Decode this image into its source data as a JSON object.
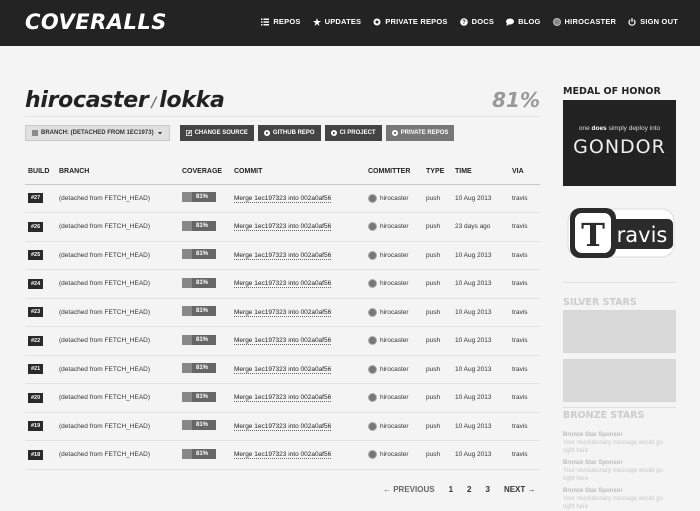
{
  "app": {
    "logo": "COVERALLS"
  },
  "nav": [
    {
      "label": "REPOS",
      "icon": "list-icon"
    },
    {
      "label": "UPDATES",
      "icon": "star-icon"
    },
    {
      "label": "PRIVATE REPOS",
      "icon": "circle-icon"
    },
    {
      "label": "DOCS",
      "icon": "question-icon"
    },
    {
      "label": "BLOG",
      "icon": "chat-icon"
    },
    {
      "label": "HIROCASTER",
      "icon": "avatar"
    },
    {
      "label": "SIGN OUT",
      "icon": "power-icon"
    }
  ],
  "repo": {
    "owner": "hirocaster",
    "separator": "/",
    "name": "lokka",
    "coverage": "81%"
  },
  "toolbar": {
    "branch_label": "BRANCH: (DETACHED FROM 1EC1973)",
    "change_source": "CHANGE SOURCE",
    "github_repo": "GITHUB REPO",
    "ci_project": "CI PROJECT",
    "private_repos": "PRIVATE REPOS"
  },
  "table": {
    "headers": [
      "BUILD",
      "BRANCH",
      "COVERAGE",
      "COMMIT",
      "COMMITTER",
      "TYPE",
      "TIME",
      "VIA"
    ],
    "rows": [
      {
        "build": "#27",
        "branch": "(detached from FETCH_HEAD)",
        "coverage": "81%",
        "commit": "Merge 1ec197323 into 002a0af56",
        "committer": "hirocaster",
        "type": "push",
        "time": "10 Aug 2013",
        "via": "travis"
      },
      {
        "build": "#26",
        "branch": "(detached from FETCH_HEAD)",
        "coverage": "81%",
        "commit": "Merge 1ec197323 into 002a0af56",
        "committer": "hirocaster",
        "type": "push",
        "time": "23 days ago",
        "via": "travis"
      },
      {
        "build": "#25",
        "branch": "(detached from FETCH_HEAD)",
        "coverage": "81%",
        "commit": "Merge 1ec197323 into 002a0af56",
        "committer": "hirocaster",
        "type": "push",
        "time": "10 Aug 2013",
        "via": "travis"
      },
      {
        "build": "#24",
        "branch": "(detached from FETCH_HEAD)",
        "coverage": "81%",
        "commit": "Merge 1ec197323 into 002a0af56",
        "committer": "hirocaster",
        "type": "push",
        "time": "10 Aug 2013",
        "via": "travis"
      },
      {
        "build": "#23",
        "branch": "(detached from FETCH_HEAD)",
        "coverage": "81%",
        "commit": "Merge 1ec197323 into 002a0af56",
        "committer": "hirocaster",
        "type": "push",
        "time": "10 Aug 2013",
        "via": "travis"
      },
      {
        "build": "#22",
        "branch": "(detached from FETCH_HEAD)",
        "coverage": "81%",
        "commit": "Merge 1ec197323 into 002a0af56",
        "committer": "hirocaster",
        "type": "push",
        "time": "10 Aug 2013",
        "via": "travis"
      },
      {
        "build": "#21",
        "branch": "(detached from FETCH_HEAD)",
        "coverage": "81%",
        "commit": "Merge 1ec197323 into 002a0af56",
        "committer": "hirocaster",
        "type": "push",
        "time": "10 Aug 2013",
        "via": "travis"
      },
      {
        "build": "#20",
        "branch": "(detached from FETCH_HEAD)",
        "coverage": "81%",
        "commit": "Merge 1ec197323 into 002a0af56",
        "committer": "hirocaster",
        "type": "push",
        "time": "10 Aug 2013",
        "via": "travis"
      },
      {
        "build": "#19",
        "branch": "(detached from FETCH_HEAD)",
        "coverage": "81%",
        "commit": "Merge 1ec197323 into 002a0af56",
        "committer": "hirocaster",
        "type": "push",
        "time": "10 Aug 2013",
        "via": "travis"
      },
      {
        "build": "#18",
        "branch": "(detached from FETCH_HEAD)",
        "coverage": "81%",
        "commit": "Merge 1ec197323 into 002a0af56",
        "committer": "hirocaster",
        "type": "push",
        "time": "10 Aug 2013",
        "via": "travis"
      }
    ]
  },
  "pagination": {
    "prev": "← PREVIOUS",
    "pages": [
      "1",
      "2",
      "3"
    ],
    "next": "NEXT →"
  },
  "sidebar": {
    "medal_title": "MEDAL OF HONOR",
    "gondor_pre": "one ",
    "gondor_bold": "does",
    "gondor_post": " simply deploy into",
    "gondor_big": "GONDOR",
    "travis_letter": "T",
    "travis_text": "ravis",
    "silver_title": "SILVER STARS",
    "bronze_title": "BRONZE STARS",
    "bronze_items": [
      {
        "title": "Bronze Star Sponsor",
        "text": "Your revolutionary message would go right here"
      },
      {
        "title": "Bronze Star Sponsor",
        "text": "Your revolutionary message would go right here"
      },
      {
        "title": "Bronze Star Sponsor",
        "text": "Your revolutionary message would go right here"
      }
    ]
  }
}
